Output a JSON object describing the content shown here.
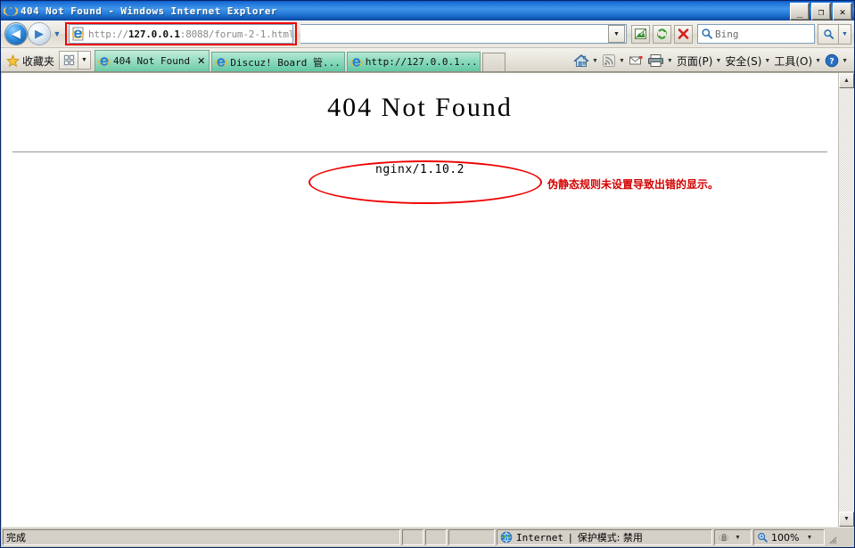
{
  "window": {
    "title": "404 Not Found - Windows Internet Explorer",
    "icon": "ie-logo-icon",
    "minimize_label": "_",
    "maximize_label": "❐",
    "close_label": "✕"
  },
  "navigation": {
    "back_label": "◀",
    "forward_label": "▶",
    "history_caret": "▼",
    "address": {
      "full": "http://127.0.0.1:8088/forum-2-1.html",
      "prefix": "http://",
      "host": "127.0.0.1",
      "suffix": ":8088/forum-2-1.html",
      "icon": "ie-page-icon",
      "dropdown_caret": "▼"
    },
    "buttons": [
      {
        "name": "compatibility-view-icon",
        "glyph": "▦"
      },
      {
        "name": "refresh-icon",
        "glyph": "↻"
      },
      {
        "name": "stop-icon",
        "glyph": "✕"
      }
    ],
    "search": {
      "placeholder": "Bing",
      "icon": "magnifier-icon",
      "go_icon": "magnifier-icon",
      "caret": "▼"
    }
  },
  "favorites": {
    "label": "收藏夹",
    "star_icon": "star-icon",
    "grid_icon": "grid-icon",
    "caret": "▼"
  },
  "tabs": [
    {
      "label": "404 Not Found",
      "icon": "ie-page-icon",
      "close": "✕",
      "active": true
    },
    {
      "label": "Discuz! Board 管...",
      "icon": "ie-page-icon",
      "active": false
    },
    {
      "label": "http://127.0.0.1...",
      "icon": "ie-page-icon",
      "active": false
    }
  ],
  "toolbar_right": [
    {
      "name": "home-icon",
      "label": "",
      "caret": "▼"
    },
    {
      "name": "feeds-icon",
      "label": "",
      "caret": "▼"
    },
    {
      "name": "mail-icon",
      "label": "",
      "caret": ""
    },
    {
      "name": "print-icon",
      "label": "",
      "caret": "▼"
    },
    {
      "name": "page-menu",
      "label": "页面(P)",
      "caret": "▼"
    },
    {
      "name": "safety-menu",
      "label": "安全(S)",
      "caret": "▼"
    },
    {
      "name": "tools-menu",
      "label": "工具(O)",
      "caret": "▼"
    },
    {
      "name": "help-icon",
      "label": "",
      "caret": "▼"
    }
  ],
  "page": {
    "heading": "404 Not Found",
    "server": "nginx/1.10.2",
    "annotation_note": "伪静态规则未设置导致出错的显示。",
    "annotation_colors": {
      "ellipse": "#ee0000",
      "note_text": "#d40000",
      "address_box": "#ee0000"
    }
  },
  "scrollbar": {
    "up_arrow": "▲",
    "down_arrow": "▼"
  },
  "status_bar": {
    "message": "完成",
    "zone_icon": "globe-icon",
    "zone": "Internet",
    "separator": "|",
    "protected_mode": "保护模式: 禁用",
    "privacy_icon": "privacy-lock-icon",
    "privacy_caret": "▼",
    "zoom_icon": "zoom-icon",
    "zoom_level": "100%",
    "zoom_caret": "▼"
  }
}
